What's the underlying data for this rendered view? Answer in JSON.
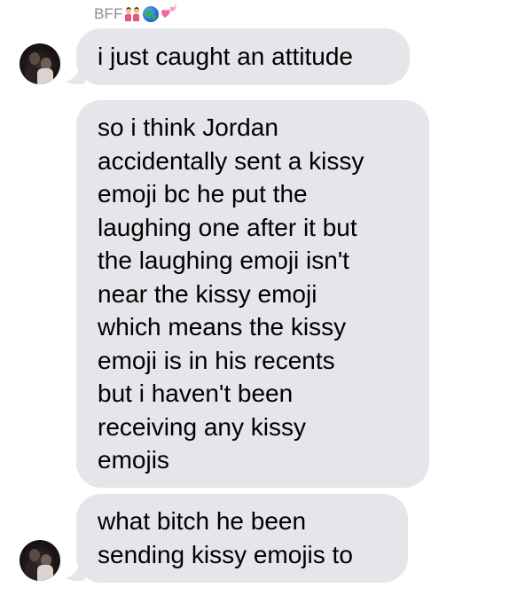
{
  "conversation": {
    "sender_name": "BFF",
    "sender_emojis": [
      "twins-emoji",
      "globe-emoji",
      "sparkling-hearts-emoji"
    ]
  },
  "messages": [
    {
      "from": "BFF",
      "lines": [
        "i just caught an attitude"
      ]
    },
    {
      "from": "BFF",
      "lines": [
        "so i think Jordan",
        "accidentally sent a kissy",
        "emoji bc he put the",
        "laughing one after it but",
        "the laughing emoji isn't",
        "near the kissy emoji",
        "which means the kissy",
        "emoji is in his recents",
        "but i haven't been",
        "receiving any kissy",
        "emojis"
      ]
    },
    {
      "from": "BFF",
      "lines": [
        "what bitch he been",
        "sending kissy emojis to"
      ]
    }
  ],
  "colors": {
    "incoming_bubble": "#e5e5ea",
    "sender_label": "#8e8e93",
    "background": "#ffffff"
  }
}
